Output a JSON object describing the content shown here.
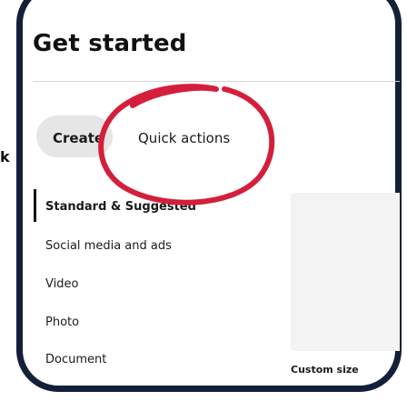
{
  "header": {
    "title": "Get started"
  },
  "tabs": [
    {
      "label": "Create",
      "selected": true
    },
    {
      "label": "Quick actions",
      "selected": false
    }
  ],
  "offscreen_fragment": "k",
  "nav": {
    "items": [
      {
        "label": "Standard & Suggested",
        "active": true
      },
      {
        "label": "Social media and ads",
        "active": false
      },
      {
        "label": "Video",
        "active": false
      },
      {
        "label": "Photo",
        "active": false
      },
      {
        "label": "Document",
        "active": false
      }
    ]
  },
  "preview": {
    "caption": "Custom size"
  },
  "colors": {
    "frame": "#14203a",
    "highlight_circle": "#d41f3c",
    "tab_bg": "#e6e6e6",
    "card_bg": "#f3f3f3"
  }
}
